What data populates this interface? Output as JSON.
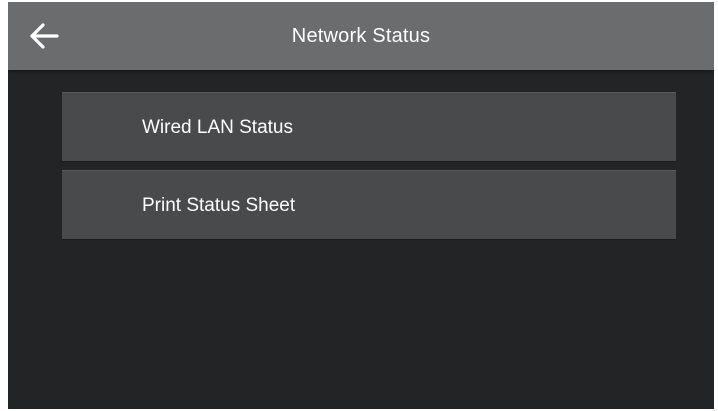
{
  "header": {
    "title": "Network Status",
    "back_icon": "arrow-left-icon"
  },
  "menu": {
    "items": [
      {
        "label": "Wired LAN Status"
      },
      {
        "label": "Print Status Sheet"
      }
    ]
  },
  "colors": {
    "background": "#222426",
    "header": "#6a6c6e",
    "menu_item": "#484a4c",
    "text": "#ffffff"
  }
}
